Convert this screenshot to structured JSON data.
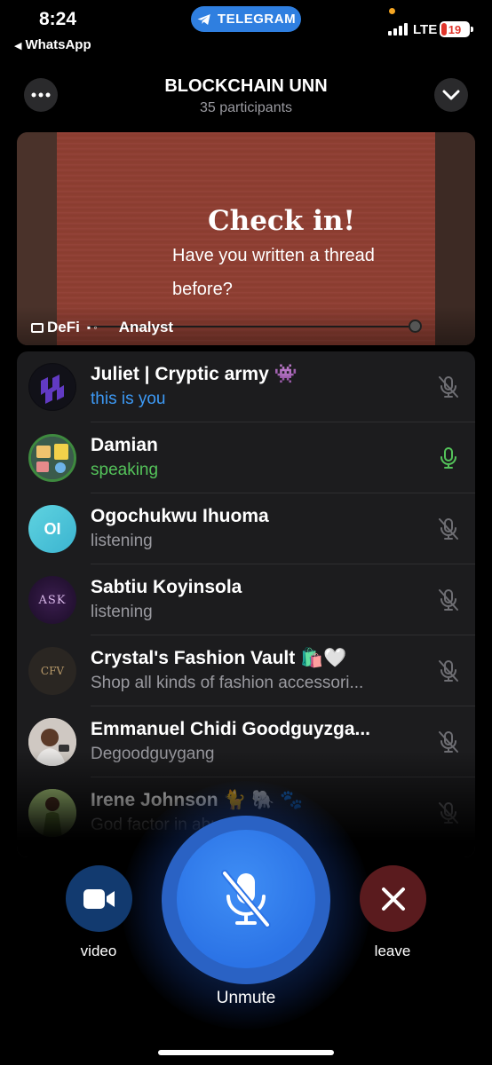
{
  "status_bar": {
    "time": "8:24",
    "back_app": "WhatsApp",
    "telegram_pill": "TELEGRAM",
    "network": "LTE",
    "battery": "19"
  },
  "header": {
    "title": "BLOCKCHAIN UNN",
    "subtitle": "35 participants",
    "more_icon": "ellipsis-icon",
    "collapse_icon": "chevron-down-icon"
  },
  "video_tile": {
    "slide_title": "Check in!",
    "slide_line1": "Have you written a thread",
    "slide_line2": "before?",
    "name_left": "DeFi",
    "name_right": "Analyst"
  },
  "participants": [
    {
      "name": "Juliet | Cryptic army 👾",
      "status": "this is you",
      "status_type": "you",
      "mic": "mic-off-icon"
    },
    {
      "name": "Damian",
      "status": "speaking",
      "status_type": "speaking",
      "mic": "mic-on-icon"
    },
    {
      "name": "Ogochukwu Ihuoma",
      "status": "listening",
      "status_type": "listening",
      "mic": "mic-off-icon",
      "initials": "OI"
    },
    {
      "name": "Sabtiu Koyinsola",
      "status": "listening",
      "status_type": "listening",
      "mic": "mic-off-icon",
      "initials": "ASK"
    },
    {
      "name": "Crystal's Fashion Vault 🛍️🤍",
      "status": "Shop all kinds of fashion accessori...",
      "status_type": "bio",
      "mic": "mic-off-icon",
      "initials": "CFV"
    },
    {
      "name": "Emmanuel Chidi Goodguyzga...",
      "status": "Degoodguygang",
      "status_type": "bio",
      "mic": "mic-off-icon"
    },
    {
      "name": "Irene Johnson 🐈 🐘 🐾",
      "status": "God factor in abundance",
      "status_type": "bio",
      "mic": "mic-off-icon"
    }
  ],
  "controls": {
    "video_label": "video",
    "leave_label": "leave",
    "mute_label": "Unmute"
  },
  "colors": {
    "accent_blue": "#2b73e6",
    "speaking_green": "#54c35a",
    "you_blue": "#3d9af6",
    "leave_red": "#5a1b1e"
  }
}
